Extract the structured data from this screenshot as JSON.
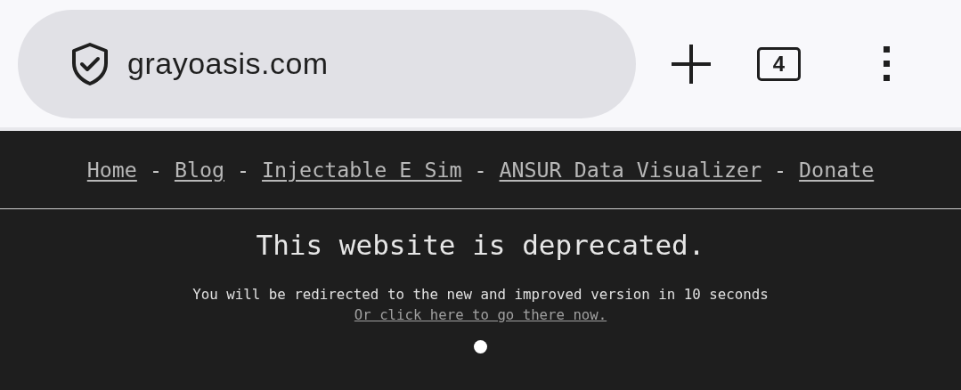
{
  "browser_toolbar": {
    "url": "grayoasis.com",
    "tab_count": "4"
  },
  "nav": [
    {
      "kind": "link",
      "text": "Home"
    },
    {
      "kind": "separator",
      "text": "-"
    },
    {
      "kind": "link",
      "text": "Blog"
    },
    {
      "kind": "separator",
      "text": "-"
    },
    {
      "kind": "link",
      "text": "Injectable E Sim"
    },
    {
      "kind": "separator",
      "text": "-"
    },
    {
      "kind": "link",
      "text": "ANSUR Data Visualizer"
    },
    {
      "kind": "separator",
      "text": "-"
    },
    {
      "kind": "link",
      "text": "Donate"
    }
  ],
  "notice": {
    "heading": "This website is deprecated.",
    "message": "You will be redirected to the new and improved version in 10 seconds",
    "link": "Or click here to go there now."
  }
}
